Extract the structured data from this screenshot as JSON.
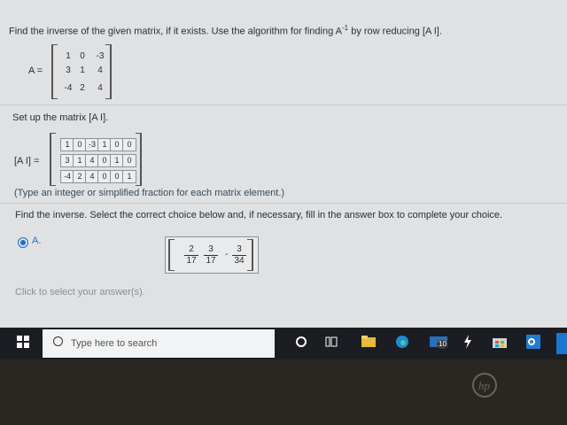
{
  "question": {
    "prompt": "Find the inverse of the given matrix, if it exists. Use the algorithm for finding A",
    "superscript": "-1",
    "prompt_end": "by row reducing [A I]."
  },
  "matrix_a": {
    "label": "A =",
    "rows": [
      [
        "1",
        "0",
        "-3"
      ],
      [
        "3",
        "1",
        "4"
      ],
      [
        "-4",
        "2",
        "4"
      ]
    ]
  },
  "setup": {
    "instruction": "Set up the matrix [A I].",
    "label": "[A I] =",
    "rows": [
      [
        "1",
        "0",
        "-3",
        "1",
        "0",
        "0"
      ],
      [
        "3",
        "1",
        "4",
        "0",
        "1",
        "0"
      ],
      [
        "-4",
        "2",
        "4",
        "0",
        "0",
        "1"
      ]
    ],
    "hint": "(Type an integer or simplified fraction for each matrix element.)"
  },
  "inverse": {
    "instruction": "Find the inverse. Select the correct choice below and, if necessary, fill in the answer box to complete your choice.",
    "choice_label": "A.",
    "fractions": [
      {
        "sign": "",
        "num": "2",
        "den": "17"
      },
      {
        "sign": "",
        "num": "3",
        "den": "17"
      },
      {
        "sign": "-",
        "num": "3",
        "den": "34"
      }
    ]
  },
  "footer": {
    "hint": "Click to select your answer(s)."
  },
  "taskbar": {
    "search_placeholder": "Type here to search",
    "mail_badge": "10",
    "icons": [
      "windows-icon",
      "search-icon",
      "cortana-icon",
      "task-view-icon",
      "file-explorer-icon",
      "edge-icon",
      "mail-icon",
      "sparkle-icon",
      "store-icon",
      "outlook-icon"
    ]
  },
  "colors": {
    "accent": "#1e6fd0",
    "page": "#dfe1e3",
    "taskbar": "#1b1d22"
  }
}
